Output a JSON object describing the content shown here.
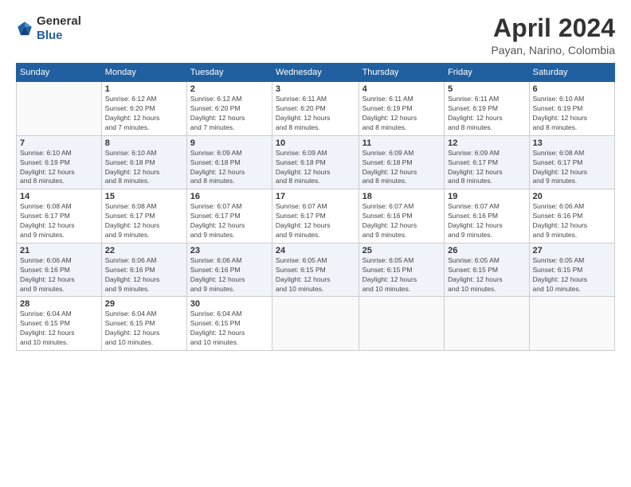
{
  "logo": {
    "general": "General",
    "blue": "Blue"
  },
  "title": "April 2024",
  "location": "Payan, Narino, Colombia",
  "days_of_week": [
    "Sunday",
    "Monday",
    "Tuesday",
    "Wednesday",
    "Thursday",
    "Friday",
    "Saturday"
  ],
  "weeks": [
    [
      {
        "day": "",
        "info": ""
      },
      {
        "day": "1",
        "info": "Sunrise: 6:12 AM\nSunset: 6:20 PM\nDaylight: 12 hours\nand 7 minutes."
      },
      {
        "day": "2",
        "info": "Sunrise: 6:12 AM\nSunset: 6:20 PM\nDaylight: 12 hours\nand 7 minutes."
      },
      {
        "day": "3",
        "info": "Sunrise: 6:11 AM\nSunset: 6:20 PM\nDaylight: 12 hours\nand 8 minutes."
      },
      {
        "day": "4",
        "info": "Sunrise: 6:11 AM\nSunset: 6:19 PM\nDaylight: 12 hours\nand 8 minutes."
      },
      {
        "day": "5",
        "info": "Sunrise: 6:11 AM\nSunset: 6:19 PM\nDaylight: 12 hours\nand 8 minutes."
      },
      {
        "day": "6",
        "info": "Sunrise: 6:10 AM\nSunset: 6:19 PM\nDaylight: 12 hours\nand 8 minutes."
      }
    ],
    [
      {
        "day": "7",
        "info": "Sunrise: 6:10 AM\nSunset: 6:19 PM\nDaylight: 12 hours\nand 8 minutes."
      },
      {
        "day": "8",
        "info": "Sunrise: 6:10 AM\nSunset: 6:18 PM\nDaylight: 12 hours\nand 8 minutes."
      },
      {
        "day": "9",
        "info": "Sunrise: 6:09 AM\nSunset: 6:18 PM\nDaylight: 12 hours\nand 8 minutes."
      },
      {
        "day": "10",
        "info": "Sunrise: 6:09 AM\nSunset: 6:18 PM\nDaylight: 12 hours\nand 8 minutes."
      },
      {
        "day": "11",
        "info": "Sunrise: 6:09 AM\nSunset: 6:18 PM\nDaylight: 12 hours\nand 8 minutes."
      },
      {
        "day": "12",
        "info": "Sunrise: 6:09 AM\nSunset: 6:17 PM\nDaylight: 12 hours\nand 8 minutes."
      },
      {
        "day": "13",
        "info": "Sunrise: 6:08 AM\nSunset: 6:17 PM\nDaylight: 12 hours\nand 9 minutes."
      }
    ],
    [
      {
        "day": "14",
        "info": "Sunrise: 6:08 AM\nSunset: 6:17 PM\nDaylight: 12 hours\nand 9 minutes."
      },
      {
        "day": "15",
        "info": "Sunrise: 6:08 AM\nSunset: 6:17 PM\nDaylight: 12 hours\nand 9 minutes."
      },
      {
        "day": "16",
        "info": "Sunrise: 6:07 AM\nSunset: 6:17 PM\nDaylight: 12 hours\nand 9 minutes."
      },
      {
        "day": "17",
        "info": "Sunrise: 6:07 AM\nSunset: 6:17 PM\nDaylight: 12 hours\nand 9 minutes."
      },
      {
        "day": "18",
        "info": "Sunrise: 6:07 AM\nSunset: 6:16 PM\nDaylight: 12 hours\nand 9 minutes."
      },
      {
        "day": "19",
        "info": "Sunrise: 6:07 AM\nSunset: 6:16 PM\nDaylight: 12 hours\nand 9 minutes."
      },
      {
        "day": "20",
        "info": "Sunrise: 6:06 AM\nSunset: 6:16 PM\nDaylight: 12 hours\nand 9 minutes."
      }
    ],
    [
      {
        "day": "21",
        "info": "Sunrise: 6:06 AM\nSunset: 6:16 PM\nDaylight: 12 hours\nand 9 minutes."
      },
      {
        "day": "22",
        "info": "Sunrise: 6:06 AM\nSunset: 6:16 PM\nDaylight: 12 hours\nand 9 minutes."
      },
      {
        "day": "23",
        "info": "Sunrise: 6:06 AM\nSunset: 6:16 PM\nDaylight: 12 hours\nand 9 minutes."
      },
      {
        "day": "24",
        "info": "Sunrise: 6:05 AM\nSunset: 6:15 PM\nDaylight: 12 hours\nand 10 minutes."
      },
      {
        "day": "25",
        "info": "Sunrise: 6:05 AM\nSunset: 6:15 PM\nDaylight: 12 hours\nand 10 minutes."
      },
      {
        "day": "26",
        "info": "Sunrise: 6:05 AM\nSunset: 6:15 PM\nDaylight: 12 hours\nand 10 minutes."
      },
      {
        "day": "27",
        "info": "Sunrise: 6:05 AM\nSunset: 6:15 PM\nDaylight: 12 hours\nand 10 minutes."
      }
    ],
    [
      {
        "day": "28",
        "info": "Sunrise: 6:04 AM\nSunset: 6:15 PM\nDaylight: 12 hours\nand 10 minutes."
      },
      {
        "day": "29",
        "info": "Sunrise: 6:04 AM\nSunset: 6:15 PM\nDaylight: 12 hours\nand 10 minutes."
      },
      {
        "day": "30",
        "info": "Sunrise: 6:04 AM\nSunset: 6:15 PM\nDaylight: 12 hours\nand 10 minutes."
      },
      {
        "day": "",
        "info": ""
      },
      {
        "day": "",
        "info": ""
      },
      {
        "day": "",
        "info": ""
      },
      {
        "day": "",
        "info": ""
      }
    ]
  ]
}
